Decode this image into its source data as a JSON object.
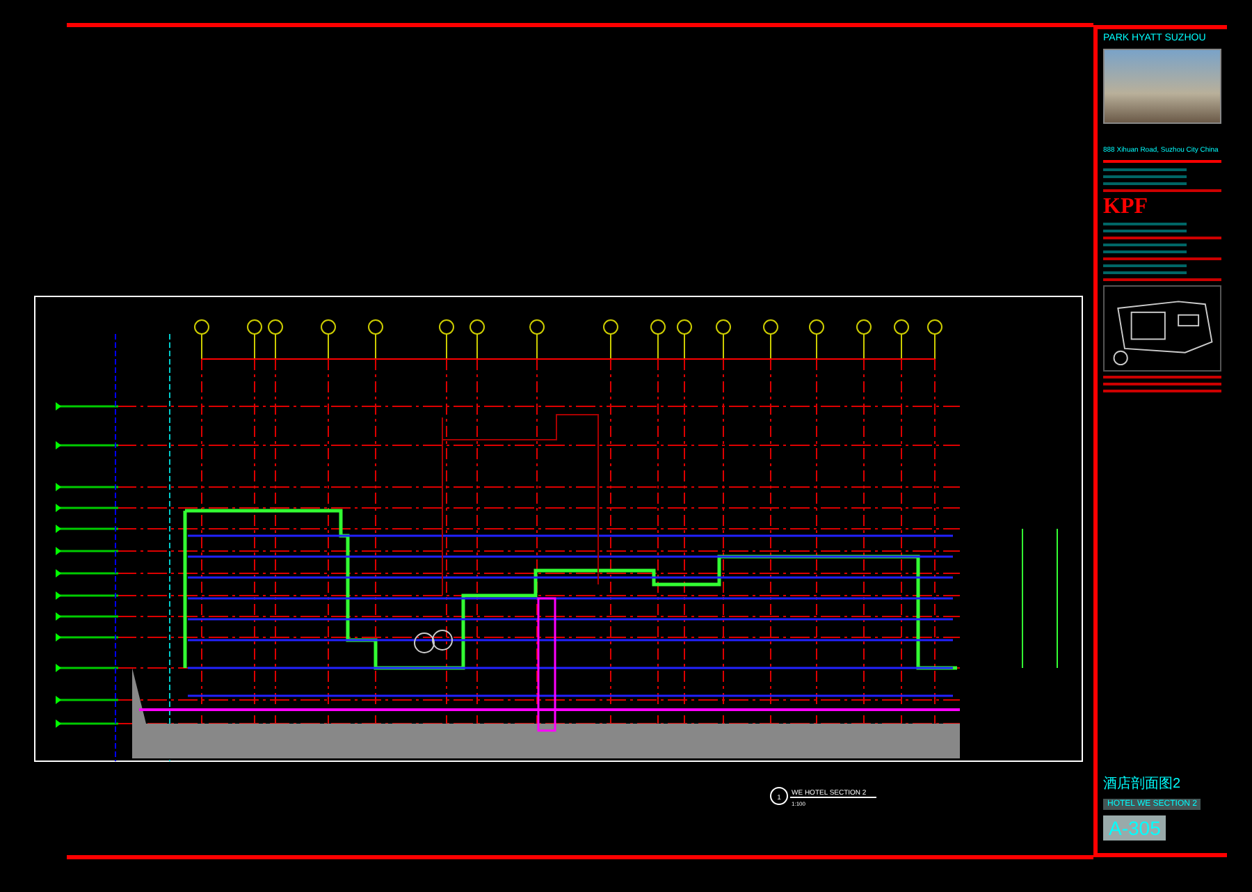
{
  "project": {
    "title": "PARK HYATT SUZHOU",
    "address": "888 Xihuan Road, Suzhou City China"
  },
  "architect": {
    "logo": "KPF"
  },
  "drawing": {
    "bubble": "1",
    "title": "WE HOTEL SECTION 2",
    "scale": "1:100"
  },
  "sheet": {
    "title_cn": "酒店剖面图2",
    "title": "HOTEL WE SECTION 2",
    "number": "A-305"
  }
}
